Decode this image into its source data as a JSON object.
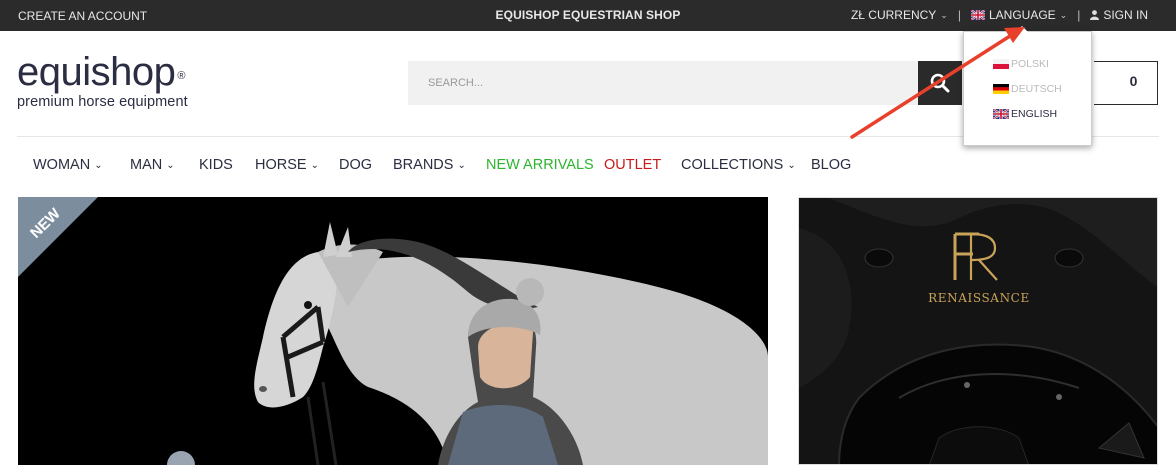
{
  "topbar": {
    "create_account": "CREATE AN ACCOUNT",
    "shop_title": "EQUISHOP EQUESTRIAN SHOP",
    "currency": "ZŁ CURRENCY",
    "separator": "|",
    "language": "LANGUAGE",
    "sign_in": "SIGN IN"
  },
  "logo": {
    "equi": "equi",
    "shop": "shop",
    "reg": "®",
    "tagline": "premium horse equipment"
  },
  "search": {
    "placeholder": "SEARCH..."
  },
  "cart": {
    "count": "0"
  },
  "nav": [
    {
      "label": "WOMAN",
      "has_dropdown": true,
      "color": "#2b2d42"
    },
    {
      "label": "MAN",
      "has_dropdown": true,
      "color": "#2b2d42"
    },
    {
      "label": "KIDS",
      "has_dropdown": false,
      "color": "#2b2d42"
    },
    {
      "label": "HORSE",
      "has_dropdown": true,
      "color": "#2b2d42"
    },
    {
      "label": "DOG",
      "has_dropdown": false,
      "color": "#2b2d42"
    },
    {
      "label": "BRANDS",
      "has_dropdown": true,
      "color": "#2b2d42"
    },
    {
      "label": "NEW ARRIVALS",
      "has_dropdown": false,
      "color": "#2db52d"
    },
    {
      "label": "OUTLET",
      "has_dropdown": false,
      "color": "#c81a1a"
    },
    {
      "label": "COLLECTIONS",
      "has_dropdown": true,
      "color": "#2b2d42"
    },
    {
      "label": "BLOG",
      "has_dropdown": false,
      "color": "#2b2d42"
    }
  ],
  "language_menu": {
    "options": [
      {
        "label": "POLSKI",
        "flag": "pl-flag",
        "active": false
      },
      {
        "label": "DEUTSCH",
        "flag": "de-flag",
        "active": false
      },
      {
        "label": "ENGLISH",
        "flag": "gb-flag",
        "active": true
      }
    ]
  },
  "banners": {
    "hero_ribbon": "NEW",
    "side_logo": "R",
    "side_title": "RENAISSANCE"
  },
  "colors": {
    "topbar_bg": "#2b2b2b",
    "annotation_arrow": "#e8402a",
    "side_gold": "#c9a35a"
  }
}
